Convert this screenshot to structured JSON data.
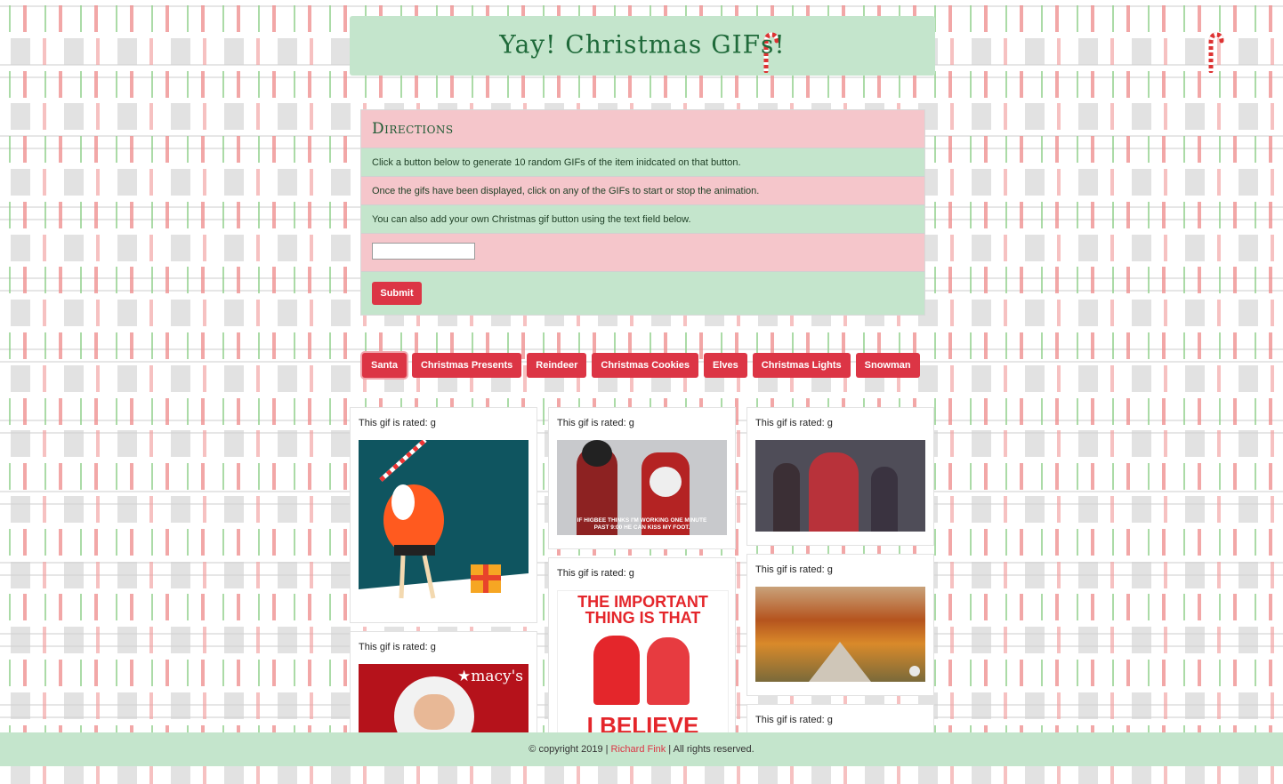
{
  "header": {
    "title": "Yay! Christmas GIFs!"
  },
  "directions": {
    "heading": "Directions",
    "line1": "Click a button below to generate 10 random GIFs of the item inidcated on that button.",
    "line2": "Once the gifs have been displayed, click on any of the GIFs to start or stop the animation.",
    "line3": "You can also add your own Christmas gif button using the text field below.",
    "input_value": "",
    "submit_label": "Submit"
  },
  "buttons": [
    "Santa",
    "Christmas Presents",
    "Reindeer",
    "Christmas Cookies",
    "Elves",
    "Christmas Lights",
    "Snowman"
  ],
  "gifs": [
    {
      "rated": "This gif is rated: g"
    },
    {
      "rated": "This gif is rated: g",
      "caption": "IF HIGBEE THINKS I'M WORKING ONE MINUTE PAST 9:00 HE CAN KISS MY FOOT."
    },
    {
      "rated": "This gif is rated: g"
    },
    {
      "rated": "This gif is rated: g",
      "caption_line1": "THE IMPORTANT",
      "caption_line2": "THING IS THAT",
      "caption_line3": "I BELIEVE"
    },
    {
      "rated": "This gif is rated: g"
    },
    {
      "rated": "This gif is rated: g",
      "brand": "★macy's"
    },
    {
      "rated": "This gif is rated: g"
    }
  ],
  "footer": {
    "copyright": "© copyright 2019 |",
    "author": "Richard Fink",
    "rights": "| All rights reserved."
  },
  "colors": {
    "accent_red": "#dc3545",
    "mint": "#c4e5cc",
    "pink": "#f5c6cb"
  }
}
